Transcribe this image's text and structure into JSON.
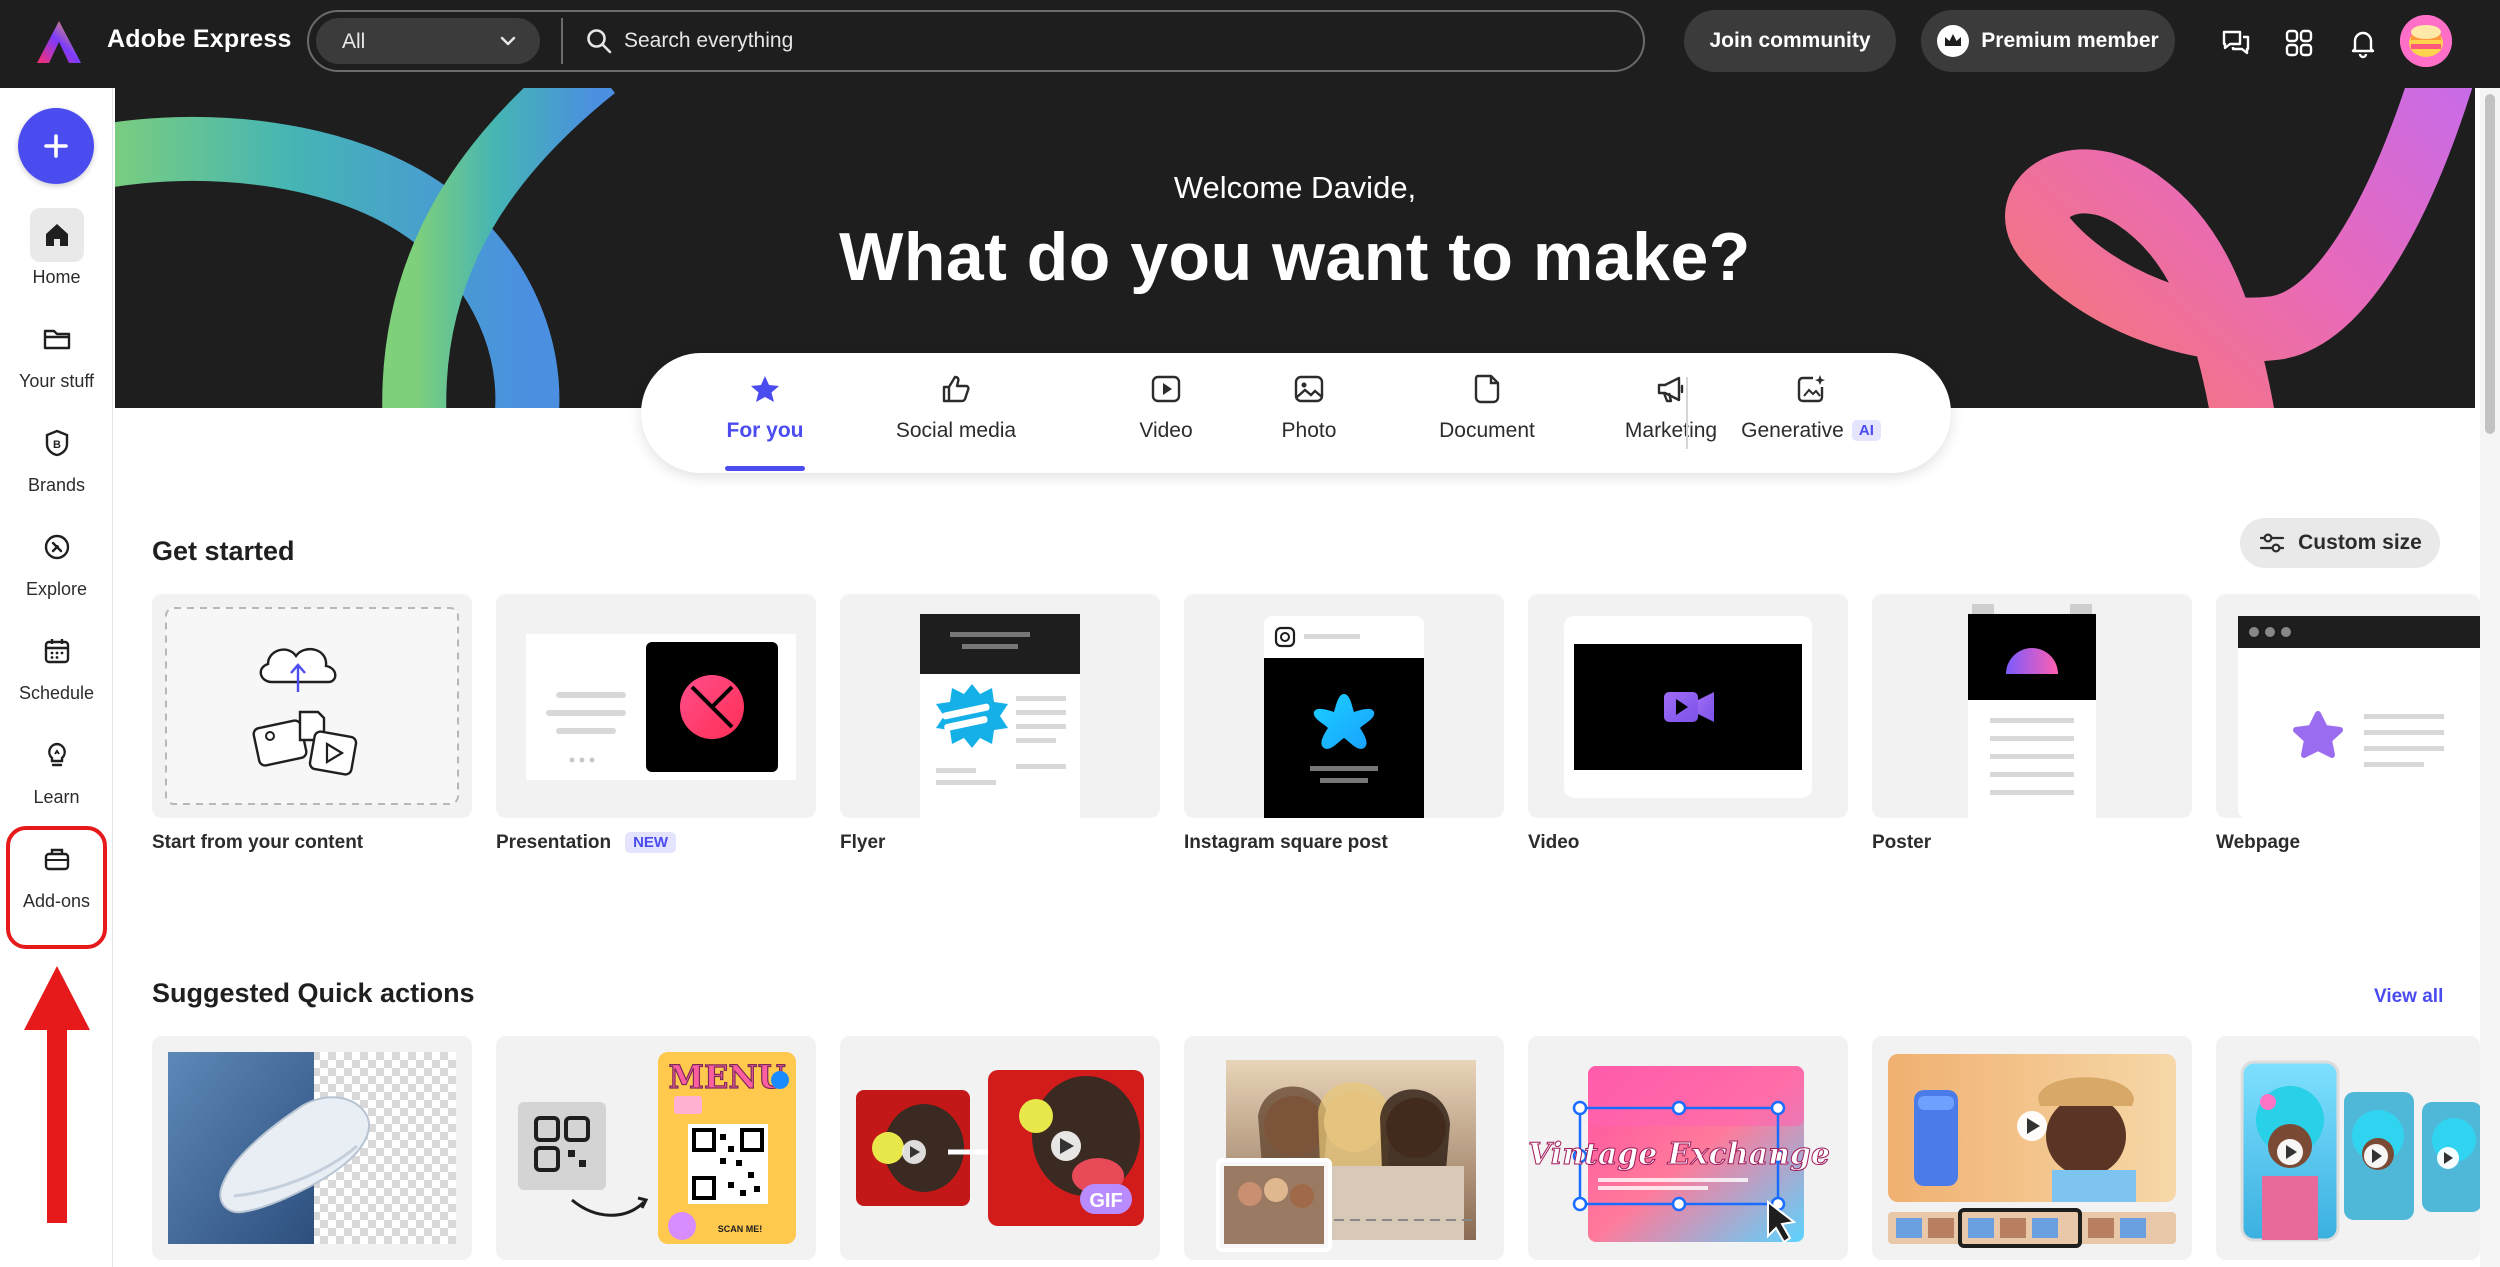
{
  "app": {
    "name": "Adobe Express"
  },
  "search": {
    "scope": "All",
    "placeholder": "Search everything"
  },
  "header": {
    "join_label": "Join community",
    "premium_label": "Premium member"
  },
  "rail": {
    "items": [
      {
        "label": "Home",
        "icon": "home-icon"
      },
      {
        "label": "Your stuff",
        "icon": "folder-icon"
      },
      {
        "label": "Brands",
        "icon": "brand-icon"
      },
      {
        "label": "Explore",
        "icon": "compass-icon"
      },
      {
        "label": "Schedule",
        "icon": "calendar-icon"
      },
      {
        "label": "Learn",
        "icon": "lightbulb-icon"
      },
      {
        "label": "Add-ons",
        "icon": "addons-icon"
      }
    ]
  },
  "hero": {
    "welcome": "Welcome Davide,",
    "title": "What do you want to make?"
  },
  "tabs": [
    {
      "label": "For you",
      "icon": "star-icon"
    },
    {
      "label": "Social media",
      "icon": "thumbs-up-icon"
    },
    {
      "label": "Video",
      "icon": "play-icon"
    },
    {
      "label": "Photo",
      "icon": "image-icon"
    },
    {
      "label": "Document",
      "icon": "document-icon"
    },
    {
      "label": "Marketing",
      "icon": "megaphone-icon"
    },
    {
      "label": "Generative",
      "icon": "sparkle-image-icon",
      "badge": "AI"
    }
  ],
  "get_started": {
    "title": "Get started",
    "custom_size_label": "Custom size",
    "cards": [
      {
        "label": "Start from your content"
      },
      {
        "label": "Presentation",
        "badge": "NEW"
      },
      {
        "label": "Flyer"
      },
      {
        "label": "Instagram square post"
      },
      {
        "label": "Video"
      },
      {
        "label": "Poster"
      },
      {
        "label": "Webpage"
      }
    ]
  },
  "quick_actions": {
    "title": "Suggested Quick actions",
    "view_all_label": "View all",
    "menu_text": "MENU",
    "scan_text": "SCAN ME!",
    "gif_text": "GIF",
    "vintage_text": "Vintage Exchange"
  },
  "colors": {
    "accent": "#4b4cf0",
    "topbar": "#1e1e1e",
    "highlight": "#e61a1a"
  }
}
